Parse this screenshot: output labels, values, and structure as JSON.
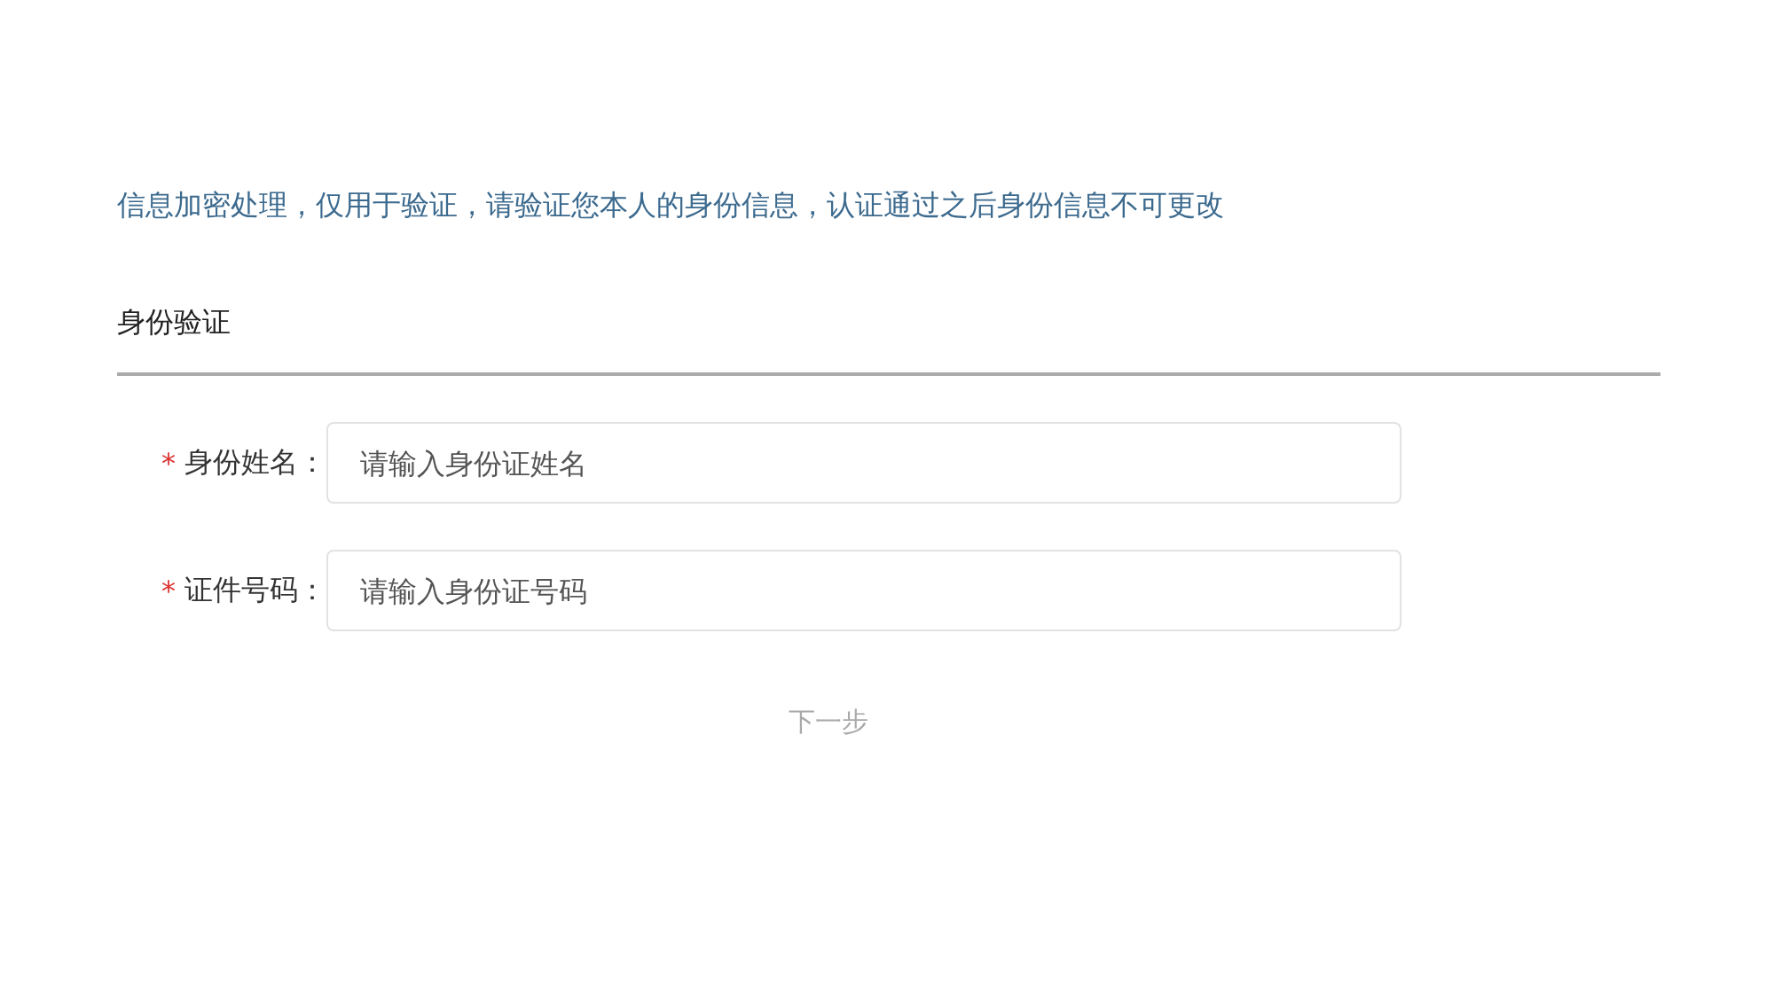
{
  "notice": "信息加密处理，仅用于验证，请验证您本人的身份信息，认证通过之后身份信息不可更改",
  "section_title": "身份验证",
  "fields": [
    {
      "required_mark": "*",
      "label": "身份姓名：",
      "placeholder": "请输入身份证姓名"
    },
    {
      "required_mark": "*",
      "label": "证件号码：",
      "placeholder": "请输入身份证号码"
    }
  ],
  "next_button": {
    "label": "下一步",
    "disabled": true
  }
}
